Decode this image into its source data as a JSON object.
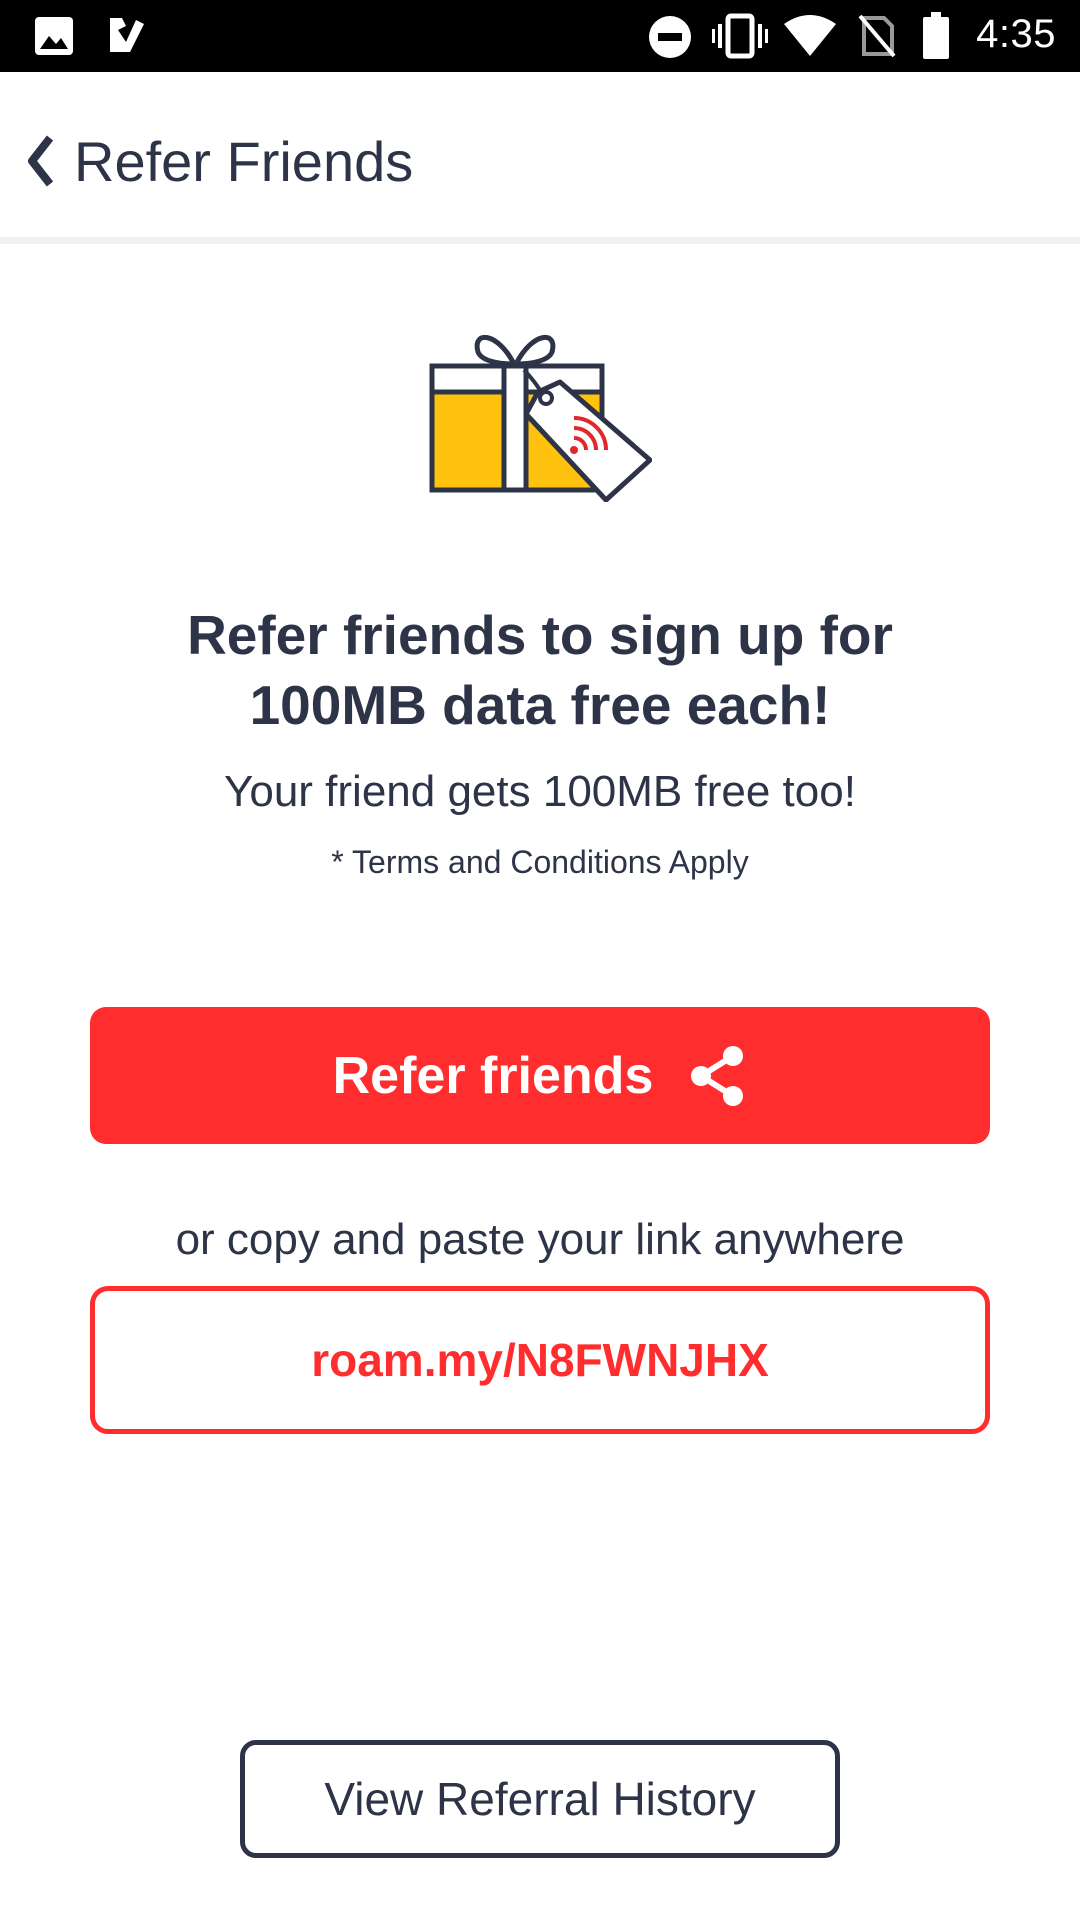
{
  "status_bar": {
    "time": "4:35",
    "icons": [
      "image-icon",
      "check-app-icon",
      "do-not-disturb-icon",
      "vibrate-icon",
      "wifi-icon",
      "no-sim-icon",
      "battery-icon"
    ]
  },
  "header": {
    "back_icon": "chevron-left-icon",
    "title": "Refer Friends"
  },
  "hero": {
    "illustration": "gift-with-tag-icon",
    "headline_line1": "Refer friends to sign up for",
    "headline_line2": "100MB data free each!",
    "subheadline": "Your friend gets 100MB free too!",
    "terms": "* Terms and Conditions Apply"
  },
  "refer_button": {
    "label": "Refer friends",
    "icon": "share-icon"
  },
  "copy_hint": "or copy and paste your link anywhere",
  "referral_link": "roam.my/N8FWNJHX",
  "history_button": {
    "label": "View Referral History"
  },
  "colors": {
    "accent": "#ff2d2d",
    "text": "#2e3447",
    "gift_yellow": "#ffc20e",
    "status_bar": "#000000"
  }
}
